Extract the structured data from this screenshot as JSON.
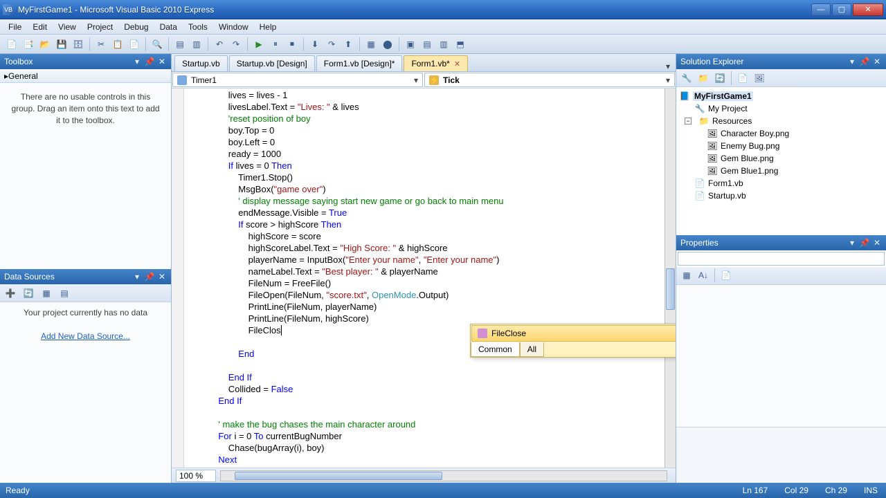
{
  "titlebar": {
    "text": "MyFirstGame1 - Microsoft Visual Basic 2010 Express"
  },
  "menus": [
    "File",
    "Edit",
    "View",
    "Project",
    "Debug",
    "Data",
    "Tools",
    "Window",
    "Help"
  ],
  "toolbox": {
    "title": "Toolbox",
    "general": "General",
    "empty": "There are no usable controls in this group. Drag an item onto this text to add it to the toolbox."
  },
  "datasources": {
    "title": "Data Sources",
    "empty": "Your project currently has no data",
    "link": "Add New Data Source..."
  },
  "tabs": [
    {
      "label": "Startup.vb"
    },
    {
      "label": "Startup.vb [Design]"
    },
    {
      "label": "Form1.vb [Design]*"
    },
    {
      "label": "Form1.vb*"
    }
  ],
  "active_tab": 3,
  "dropdowns": {
    "left": "Timer1",
    "right": "Tick"
  },
  "intellisense": {
    "item": "FileClose",
    "tabs": [
      "Common",
      "All"
    ],
    "active_tab": 0
  },
  "zoom": "100 %",
  "solution": {
    "title": "Solution Explorer",
    "project": "MyFirstGame1",
    "nodes": {
      "my_project": "My Project",
      "resources": "Resources",
      "res_items": [
        "Character Boy.png",
        "Enemy Bug.png",
        "Gem Blue.png",
        "Gem Blue1.png"
      ],
      "files": [
        "Form1.vb",
        "Startup.vb"
      ]
    }
  },
  "properties": {
    "title": "Properties"
  },
  "statusbar": {
    "ready": "Ready",
    "ln": "Ln 167",
    "col": "Col 29",
    "ch": "Ch 29",
    "ins": "INS"
  },
  "code": {
    "l1a": "                lives = lives - 1",
    "l2a": "                livesLabel.Text = ",
    "l2s": "\"Lives: \"",
    "l2b": " & lives",
    "l3": "                'reset position of boy",
    "l4": "                boy.Top = 0",
    "l5": "                boy.Left = 0",
    "l6": "                ready = 1000",
    "l7a": "                ",
    "l7if": "If",
    "l7b": " lives = 0 ",
    "l7then": "Then",
    "l8": "                    Timer1.Stop()",
    "l9a": "                    MsgBox(",
    "l9s": "\"game over\"",
    "l9b": ")",
    "l10": "                    ",
    "l10c": "' display message saying start new game or go back to main menu",
    "l11": "                    endMessage.Visible = ",
    "l11t": "True",
    "l12a": "                    ",
    "l12if": "If",
    "l12b": " score > highScore ",
    "l12then": "Then",
    "l13": "                        highScore = score",
    "l14a": "                        highScoreLabel.Text = ",
    "l14s": "\"High Score: \"",
    "l14b": " & highScore",
    "l15a": "                        playerName = InputBox(",
    "l15s1": "\"Enter your name\"",
    "l15c": ", ",
    "l15s2": "\"Enter your name\"",
    "l15b": ")",
    "l16a": "                        nameLabel.Text = ",
    "l16s": "\"Best player: \"",
    "l16b": " & playerName",
    "l17": "                        FileNum = FreeFile()",
    "l18a": "                        FileOpen(FileNum, ",
    "l18s": "\"score.txt\"",
    "l18b": ", ",
    "l18t": "OpenMode",
    "l18c": ".Output)",
    "l19": "                        PrintLine(FileNum, playerName)",
    "l20": "                        PrintLine(FileNum, highScore)",
    "l21": "                        FileClos",
    "l22": "",
    "l23a": "                    ",
    "l23e": "End",
    "l24": "",
    "l25a": "                ",
    "l25e": "End",
    "l25if": " If",
    "l26a": "                Collided = ",
    "l26f": "False",
    "l27a": "            ",
    "l27e": "End",
    "l27if": " If",
    "l28": "",
    "l29": "            ",
    "l29c": "' make the bug chases the main character around",
    "l30a": "            ",
    "l30f": "For",
    "l30b": " i = 0 ",
    "l30to": "To",
    "l30c": " currentBugNumber",
    "l31": "                Chase(bugArray(i), boy)",
    "l32a": "            ",
    "l32n": "Next",
    "l33": ""
  }
}
